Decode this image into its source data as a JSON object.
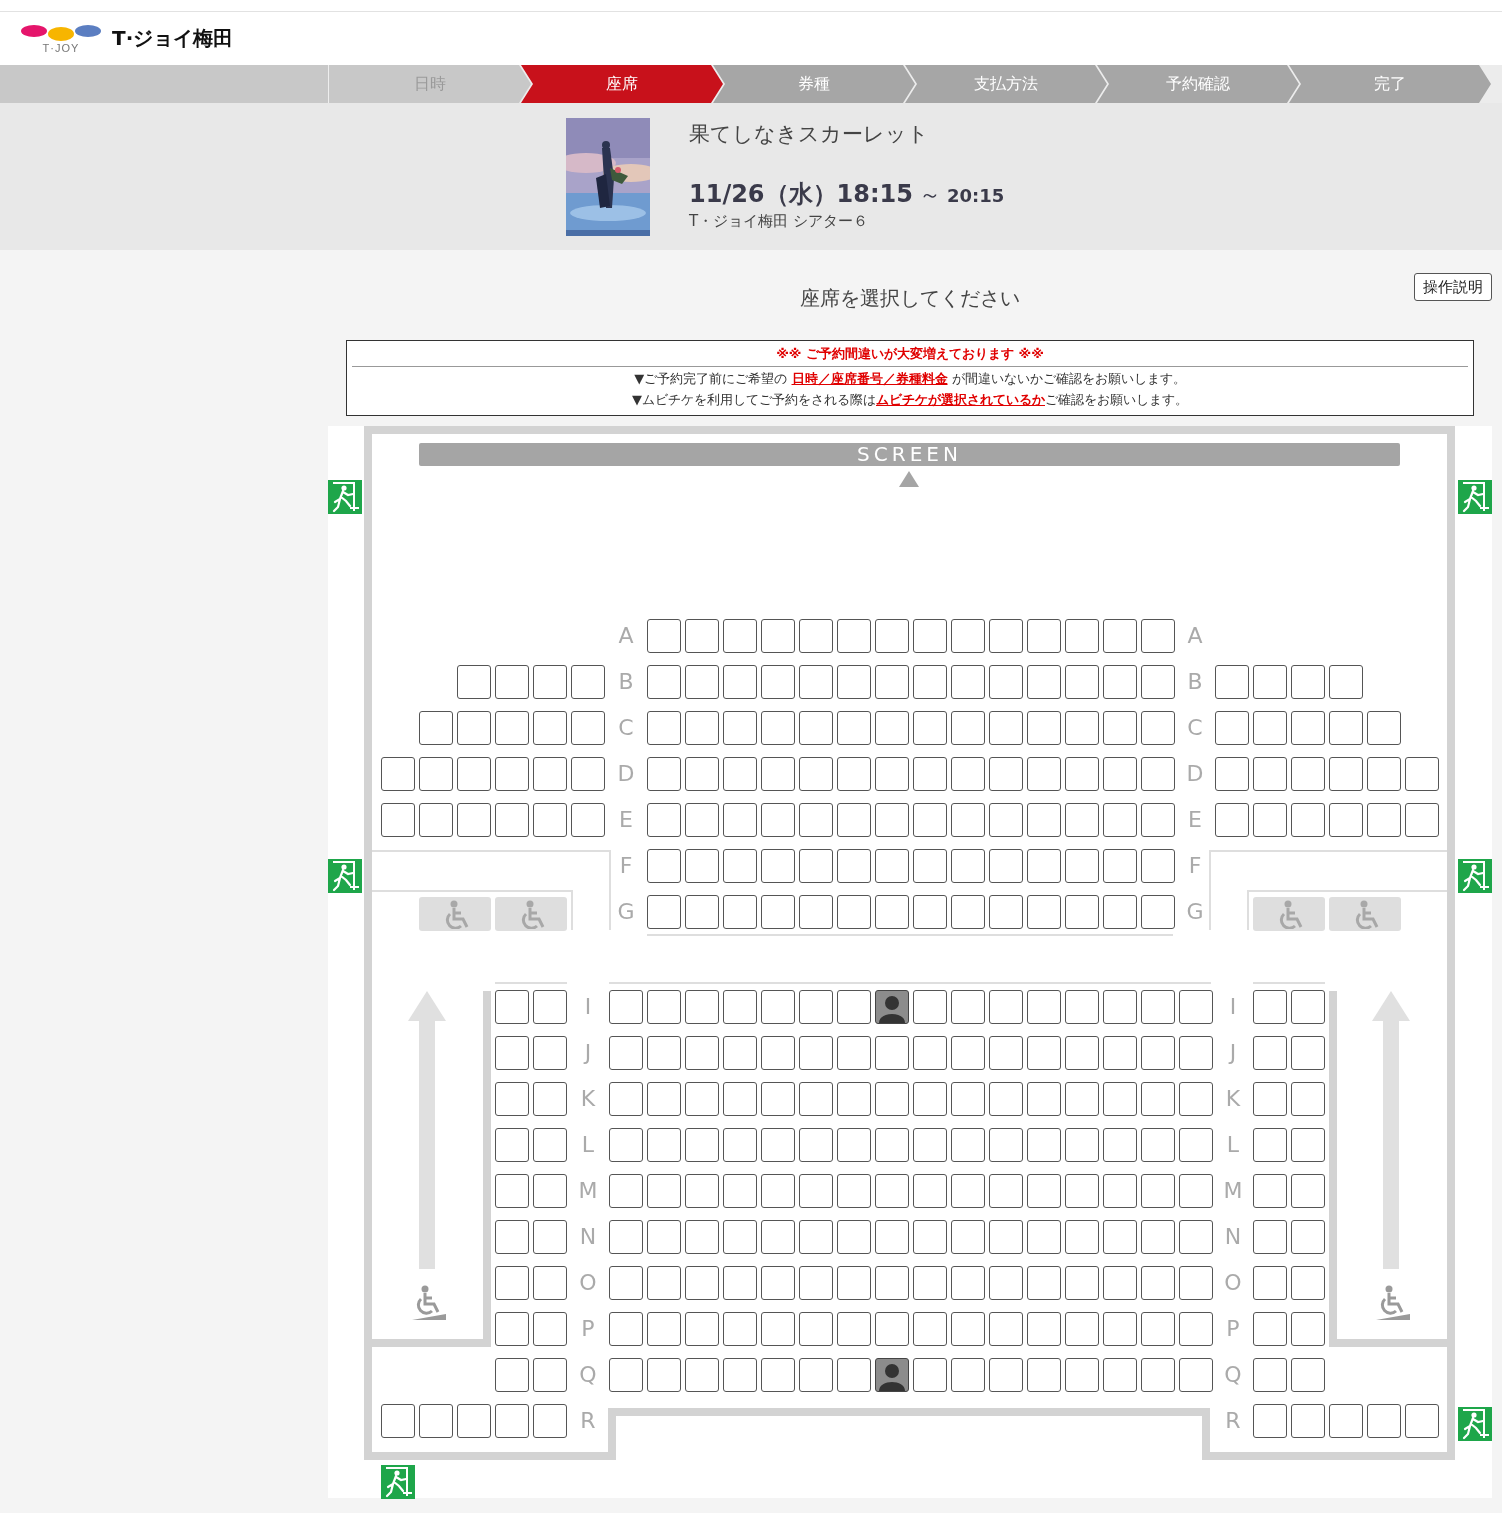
{
  "header": {
    "logo_text": "T·JOY",
    "site_name": "T·ジョイ梅田"
  },
  "steps": [
    {
      "label": "日時",
      "selected": false,
      "completed": true
    },
    {
      "label": "座席",
      "selected": true,
      "completed": false
    },
    {
      "label": "券種",
      "selected": false,
      "completed": false
    },
    {
      "label": "支払方法",
      "selected": false,
      "completed": false
    },
    {
      "label": "予約確認",
      "selected": false,
      "completed": false
    },
    {
      "label": "完了",
      "selected": false,
      "completed": false
    }
  ],
  "movie": {
    "title": "果てしなきスカーレット",
    "date": "11/26（水）18:15",
    "separator": "～",
    "end_time": "20:15",
    "venue": "T・ジョイ梅田 シアター６"
  },
  "prompt": "座席を選択してください",
  "help_button": "操作説明",
  "notice": {
    "title": "※※ ご予約間違いが大変増えております ※※",
    "lines": [
      {
        "before": "▼ご予約完了前にご希望の ",
        "link": "日時／座席番号／券種料金",
        "after": " が間違いないかご確認をお願いします。"
      },
      {
        "before": "▼ムビチケを利用してご予約をされる際は",
        "link": "ムビチケが選択されているか",
        "after": "ご確認をお願いします。"
      }
    ]
  },
  "seat_map": {
    "screen_label": "SCREEN",
    "sections": [
      {
        "kind": "front",
        "rows": [
          {
            "label_left": "A",
            "label_right": "A",
            "left": [],
            "center": [
              {
                "occupied": false
              },
              {
                "occupied": false
              },
              {
                "occupied": false
              },
              {
                "occupied": false
              },
              {
                "occupied": false
              },
              {
                "occupied": false
              },
              {
                "occupied": false
              },
              {
                "occupied": false
              },
              {
                "occupied": false
              },
              {
                "occupied": false
              },
              {
                "occupied": false
              },
              {
                "occupied": false
              },
              {
                "occupied": false
              },
              {
                "occupied": false
              }
            ],
            "right": []
          },
          {
            "label_left": "B",
            "label_right": "B",
            "left": [
              {
                "occupied": false
              },
              {
                "occupied": false
              },
              {
                "occupied": false
              },
              {
                "occupied": false
              }
            ],
            "center": [
              {
                "occupied": false
              },
              {
                "occupied": false
              },
              {
                "occupied": false
              },
              {
                "occupied": false
              },
              {
                "occupied": false
              },
              {
                "occupied": false
              },
              {
                "occupied": false
              },
              {
                "occupied": false
              },
              {
                "occupied": false
              },
              {
                "occupied": false
              },
              {
                "occupied": false
              },
              {
                "occupied": false
              },
              {
                "occupied": false
              },
              {
                "occupied": false
              }
            ],
            "right": [
              {
                "occupied": false
              },
              {
                "occupied": false
              },
              {
                "occupied": false
              },
              {
                "occupied": false
              }
            ]
          },
          {
            "label_left": "C",
            "label_right": "C",
            "left": [
              {
                "occupied": false
              },
              {
                "occupied": false
              },
              {
                "occupied": false
              },
              {
                "occupied": false
              },
              {
                "occupied": false
              }
            ],
            "center": [
              {
                "occupied": false
              },
              {
                "occupied": false
              },
              {
                "occupied": false
              },
              {
                "occupied": false
              },
              {
                "occupied": false
              },
              {
                "occupied": false
              },
              {
                "occupied": false
              },
              {
                "occupied": false
              },
              {
                "occupied": false
              },
              {
                "occupied": false
              },
              {
                "occupied": false
              },
              {
                "occupied": false
              },
              {
                "occupied": false
              },
              {
                "occupied": false
              }
            ],
            "right": [
              {
                "occupied": false
              },
              {
                "occupied": false
              },
              {
                "occupied": false
              },
              {
                "occupied": false
              },
              {
                "occupied": false
              }
            ]
          },
          {
            "label_left": "D",
            "label_right": "D",
            "left": [
              {
                "occupied": false
              },
              {
                "occupied": false
              },
              {
                "occupied": false
              },
              {
                "occupied": false
              },
              {
                "occupied": false
              },
              {
                "occupied": false
              }
            ],
            "center": [
              {
                "occupied": false
              },
              {
                "occupied": false
              },
              {
                "occupied": false
              },
              {
                "occupied": false
              },
              {
                "occupied": false
              },
              {
                "occupied": false
              },
              {
                "occupied": false
              },
              {
                "occupied": false
              },
              {
                "occupied": false
              },
              {
                "occupied": false
              },
              {
                "occupied": false
              },
              {
                "occupied": false
              },
              {
                "occupied": false
              },
              {
                "occupied": false
              }
            ],
            "right": [
              {
                "occupied": false
              },
              {
                "occupied": false
              },
              {
                "occupied": false
              },
              {
                "occupied": false
              },
              {
                "occupied": false
              },
              {
                "occupied": false
              }
            ]
          },
          {
            "label_left": "E",
            "label_right": "E",
            "left": [
              {
                "occupied": false
              },
              {
                "occupied": false
              },
              {
                "occupied": false
              },
              {
                "occupied": false
              },
              {
                "occupied": false
              },
              {
                "occupied": false
              }
            ],
            "center": [
              {
                "occupied": false
              },
              {
                "occupied": false
              },
              {
                "occupied": false
              },
              {
                "occupied": false
              },
              {
                "occupied": false
              },
              {
                "occupied": false
              },
              {
                "occupied": false
              },
              {
                "occupied": false
              },
              {
                "occupied": false
              },
              {
                "occupied": false
              },
              {
                "occupied": false
              },
              {
                "occupied": false
              },
              {
                "occupied": false
              },
              {
                "occupied": false
              }
            ],
            "right": [
              {
                "occupied": false
              },
              {
                "occupied": false
              },
              {
                "occupied": false
              },
              {
                "occupied": false
              },
              {
                "occupied": false
              },
              {
                "occupied": false
              }
            ]
          },
          {
            "label_left": "F",
            "label_right": "F",
            "left": [],
            "center": [
              {
                "occupied": false
              },
              {
                "occupied": false
              },
              {
                "occupied": false
              },
              {
                "occupied": false
              },
              {
                "occupied": false
              },
              {
                "occupied": false
              },
              {
                "occupied": false
              },
              {
                "occupied": false
              },
              {
                "occupied": false
              },
              {
                "occupied": false
              },
              {
                "occupied": false
              },
              {
                "occupied": false
              },
              {
                "occupied": false
              },
              {
                "occupied": false
              }
            ],
            "right": []
          },
          {
            "label_left": "G",
            "label_right": "G",
            "left": [],
            "center": [
              {
                "occupied": false
              },
              {
                "occupied": false
              },
              {
                "occupied": false
              },
              {
                "occupied": false
              },
              {
                "occupied": false
              },
              {
                "occupied": false
              },
              {
                "occupied": false
              },
              {
                "occupied": false
              },
              {
                "occupied": false
              },
              {
                "occupied": false
              },
              {
                "occupied": false
              },
              {
                "occupied": false
              },
              {
                "occupied": false
              },
              {
                "occupied": false
              }
            ],
            "right": []
          }
        ]
      },
      {
        "kind": "rear",
        "rows": [
          {
            "label_left": "I",
            "label_right": "I",
            "left": [
              {
                "occupied": false
              },
              {
                "occupied": false
              }
            ],
            "center": [
              {
                "occupied": false
              },
              {
                "occupied": false
              },
              {
                "occupied": false
              },
              {
                "occupied": false
              },
              {
                "occupied": false
              },
              {
                "occupied": false
              },
              {
                "occupied": false
              },
              {
                "occupied": true
              },
              {
                "occupied": false
              },
              {
                "occupied": false
              },
              {
                "occupied": false
              },
              {
                "occupied": false
              },
              {
                "occupied": false
              },
              {
                "occupied": false
              },
              {
                "occupied": false
              },
              {
                "occupied": false
              }
            ],
            "right": [
              {
                "occupied": false
              },
              {
                "occupied": false
              }
            ]
          },
          {
            "label_left": "J",
            "label_right": "J",
            "left": [
              {
                "occupied": false
              },
              {
                "occupied": false
              }
            ],
            "center": [
              {
                "occupied": false
              },
              {
                "occupied": false
              },
              {
                "occupied": false
              },
              {
                "occupied": false
              },
              {
                "occupied": false
              },
              {
                "occupied": false
              },
              {
                "occupied": false
              },
              {
                "occupied": false
              },
              {
                "occupied": false
              },
              {
                "occupied": false
              },
              {
                "occupied": false
              },
              {
                "occupied": false
              },
              {
                "occupied": false
              },
              {
                "occupied": false
              },
              {
                "occupied": false
              },
              {
                "occupied": false
              }
            ],
            "right": [
              {
                "occupied": false
              },
              {
                "occupied": false
              }
            ]
          },
          {
            "label_left": "K",
            "label_right": "K",
            "left": [
              {
                "occupied": false
              },
              {
                "occupied": false
              }
            ],
            "center": [
              {
                "occupied": false
              },
              {
                "occupied": false
              },
              {
                "occupied": false
              },
              {
                "occupied": false
              },
              {
                "occupied": false
              },
              {
                "occupied": false
              },
              {
                "occupied": false
              },
              {
                "occupied": false
              },
              {
                "occupied": false
              },
              {
                "occupied": false
              },
              {
                "occupied": false
              },
              {
                "occupied": false
              },
              {
                "occupied": false
              },
              {
                "occupied": false
              },
              {
                "occupied": false
              },
              {
                "occupied": false
              }
            ],
            "right": [
              {
                "occupied": false
              },
              {
                "occupied": false
              }
            ]
          },
          {
            "label_left": "L",
            "label_right": "L",
            "left": [
              {
                "occupied": false
              },
              {
                "occupied": false
              }
            ],
            "center": [
              {
                "occupied": false
              },
              {
                "occupied": false
              },
              {
                "occupied": false
              },
              {
                "occupied": false
              },
              {
                "occupied": false
              },
              {
                "occupied": false
              },
              {
                "occupied": false
              },
              {
                "occupied": false
              },
              {
                "occupied": false
              },
              {
                "occupied": false
              },
              {
                "occupied": false
              },
              {
                "occupied": false
              },
              {
                "occupied": false
              },
              {
                "occupied": false
              },
              {
                "occupied": false
              },
              {
                "occupied": false
              }
            ],
            "right": [
              {
                "occupied": false
              },
              {
                "occupied": false
              }
            ]
          },
          {
            "label_left": "M",
            "label_right": "M",
            "left": [
              {
                "occupied": false
              },
              {
                "occupied": false
              }
            ],
            "center": [
              {
                "occupied": false
              },
              {
                "occupied": false
              },
              {
                "occupied": false
              },
              {
                "occupied": false
              },
              {
                "occupied": false
              },
              {
                "occupied": false
              },
              {
                "occupied": false
              },
              {
                "occupied": false
              },
              {
                "occupied": false
              },
              {
                "occupied": false
              },
              {
                "occupied": false
              },
              {
                "occupied": false
              },
              {
                "occupied": false
              },
              {
                "occupied": false
              },
              {
                "occupied": false
              },
              {
                "occupied": false
              }
            ],
            "right": [
              {
                "occupied": false
              },
              {
                "occupied": false
              }
            ]
          },
          {
            "label_left": "N",
            "label_right": "N",
            "left": [
              {
                "occupied": false
              },
              {
                "occupied": false
              }
            ],
            "center": [
              {
                "occupied": false
              },
              {
                "occupied": false
              },
              {
                "occupied": false
              },
              {
                "occupied": false
              },
              {
                "occupied": false
              },
              {
                "occupied": false
              },
              {
                "occupied": false
              },
              {
                "occupied": false
              },
              {
                "occupied": false
              },
              {
                "occupied": false
              },
              {
                "occupied": false
              },
              {
                "occupied": false
              },
              {
                "occupied": false
              },
              {
                "occupied": false
              },
              {
                "occupied": false
              },
              {
                "occupied": false
              }
            ],
            "right": [
              {
                "occupied": false
              },
              {
                "occupied": false
              }
            ]
          },
          {
            "label_left": "O",
            "label_right": "O",
            "left": [
              {
                "occupied": false
              },
              {
                "occupied": false
              }
            ],
            "center": [
              {
                "occupied": false
              },
              {
                "occupied": false
              },
              {
                "occupied": false
              },
              {
                "occupied": false
              },
              {
                "occupied": false
              },
              {
                "occupied": false
              },
              {
                "occupied": false
              },
              {
                "occupied": false
              },
              {
                "occupied": false
              },
              {
                "occupied": false
              },
              {
                "occupied": false
              },
              {
                "occupied": false
              },
              {
                "occupied": false
              },
              {
                "occupied": false
              },
              {
                "occupied": false
              },
              {
                "occupied": false
              }
            ],
            "right": [
              {
                "occupied": false
              },
              {
                "occupied": false
              }
            ]
          },
          {
            "label_left": "P",
            "label_right": "P",
            "left": [
              {
                "occupied": false
              },
              {
                "occupied": false
              }
            ],
            "center": [
              {
                "occupied": false
              },
              {
                "occupied": false
              },
              {
                "occupied": false
              },
              {
                "occupied": false
              },
              {
                "occupied": false
              },
              {
                "occupied": false
              },
              {
                "occupied": false
              },
              {
                "occupied": false
              },
              {
                "occupied": false
              },
              {
                "occupied": false
              },
              {
                "occupied": false
              },
              {
                "occupied": false
              },
              {
                "occupied": false
              },
              {
                "occupied": false
              },
              {
                "occupied": false
              },
              {
                "occupied": false
              }
            ],
            "right": [
              {
                "occupied": false
              },
              {
                "occupied": false
              }
            ]
          },
          {
            "label_left": "Q",
            "label_right": "Q",
            "left": [
              {
                "occupied": false
              },
              {
                "occupied": false
              }
            ],
            "center": [
              {
                "occupied": false
              },
              {
                "occupied": false
              },
              {
                "occupied": false
              },
              {
                "occupied": false
              },
              {
                "occupied": false
              },
              {
                "occupied": false
              },
              {
                "occupied": false
              },
              {
                "occupied": true
              },
              {
                "occupied": false
              },
              {
                "occupied": false
              },
              {
                "occupied": false
              },
              {
                "occupied": false
              },
              {
                "occupied": false
              },
              {
                "occupied": false
              },
              {
                "occupied": false
              },
              {
                "occupied": false
              }
            ],
            "right": [
              {
                "occupied": false
              },
              {
                "occupied": false
              }
            ]
          },
          {
            "label_left": "R",
            "label_right": "R",
            "left": [
              {
                "occupied": false
              },
              {
                "occupied": false
              },
              {
                "occupied": false
              },
              {
                "occupied": false
              },
              {
                "occupied": false
              }
            ],
            "center": [],
            "right": [
              {
                "occupied": false
              },
              {
                "occupied": false
              },
              {
                "occupied": false
              },
              {
                "occupied": false
              },
              {
                "occupied": false
              }
            ]
          }
        ]
      }
    ]
  }
}
